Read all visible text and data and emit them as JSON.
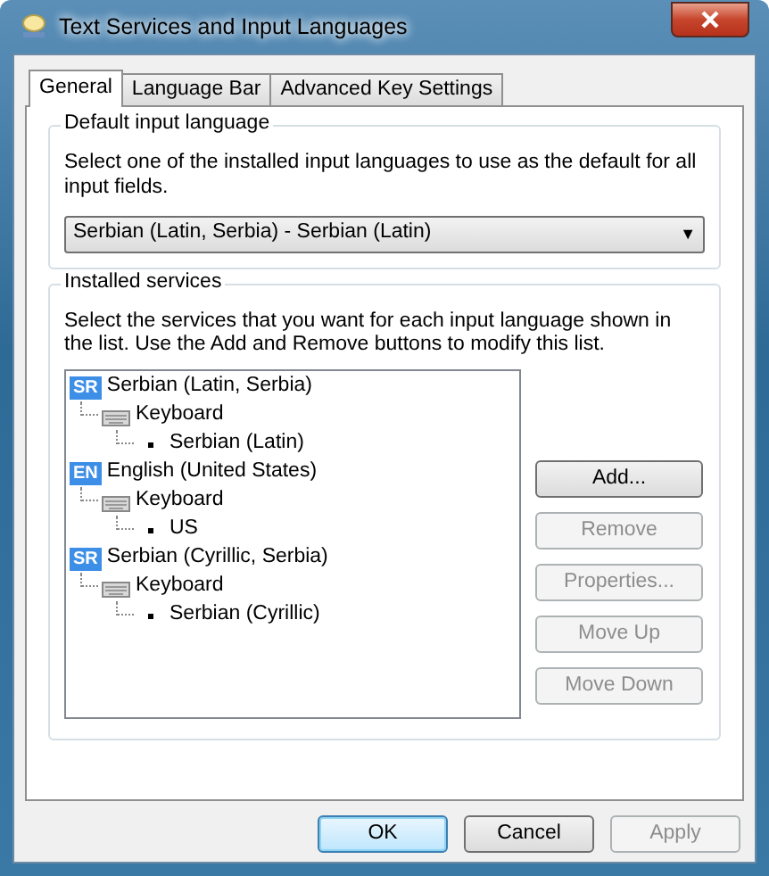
{
  "window": {
    "title": "Text Services and Input Languages"
  },
  "tabs": [
    {
      "label": "General",
      "selected": true
    },
    {
      "label": "Language Bar",
      "selected": false
    },
    {
      "label": "Advanced Key Settings",
      "selected": false
    }
  ],
  "default_input_language": {
    "title": "Default input language",
    "description": "Select one of the installed input languages to use as the default for all input fields.",
    "dropdown": {
      "value": "Serbian (Latin, Serbia) - Serbian (Latin)",
      "arrow": "▼"
    }
  },
  "installed_services": {
    "title": "Installed services",
    "description": "Select the services that you want for each input language shown in the list. Use the Add and Remove buttons to modify this list.",
    "tree": [
      {
        "code": "SR",
        "label": "Serbian (Latin, Serbia)",
        "children": [
          {
            "label": "Keyboard",
            "children": [
              {
                "label": "Serbian (Latin)"
              }
            ]
          }
        ]
      },
      {
        "code": "EN",
        "label": "English (United States)",
        "children": [
          {
            "label": "Keyboard",
            "children": [
              {
                "label": "US"
              }
            ]
          }
        ]
      },
      {
        "code": "SR",
        "label": "Serbian (Cyrillic, Serbia)",
        "children": [
          {
            "label": "Keyboard",
            "children": [
              {
                "label": "Serbian (Cyrillic)"
              }
            ]
          }
        ]
      }
    ],
    "buttons": [
      {
        "label": "Add...",
        "disabled": false
      },
      {
        "label": "Remove",
        "disabled": true
      },
      {
        "label": "Properties...",
        "disabled": true
      },
      {
        "label": "Move Up",
        "disabled": true
      },
      {
        "label": "Move Down",
        "disabled": true
      }
    ]
  },
  "footer_buttons": [
    {
      "label": "OK",
      "disabled": false,
      "default": true
    },
    {
      "label": "Cancel",
      "disabled": false,
      "default": false
    },
    {
      "label": "Apply",
      "disabled": true,
      "default": false
    }
  ]
}
